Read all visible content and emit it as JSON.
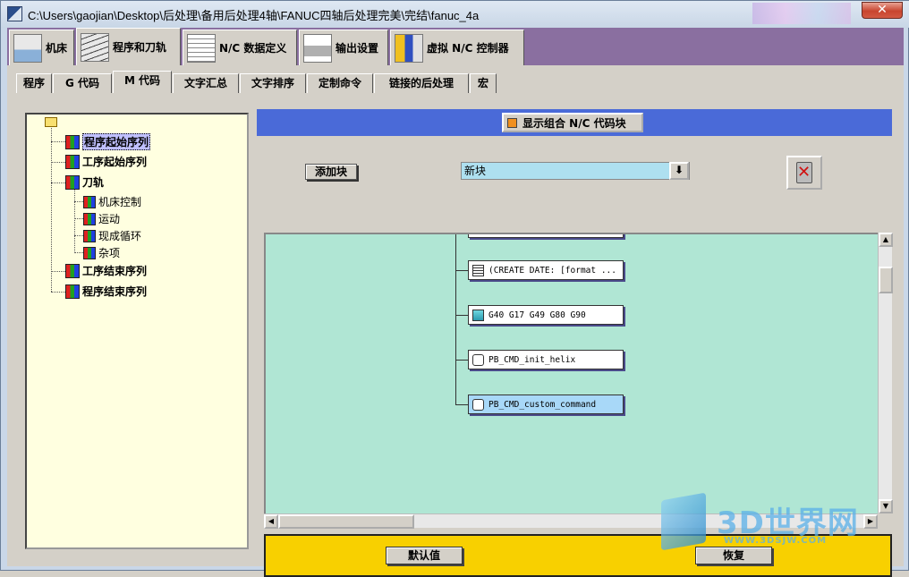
{
  "window": {
    "title": "C:\\Users\\gaojian\\Desktop\\后处理\\备用后处理4轴\\FANUC四轴后处理完美\\完结\\fanuc_4a",
    "close": "✕"
  },
  "main_tabs": [
    {
      "label": "机床",
      "icon": "machine-icon"
    },
    {
      "label": "程序和刀轨",
      "icon": "program-path-icon"
    },
    {
      "label": "N/C 数据定义",
      "icon": "nc-data-icon"
    },
    {
      "label": "输出设置",
      "icon": "printer-icon"
    },
    {
      "label": "虚拟 N/C 控制器",
      "icon": "virtual-controller-icon"
    }
  ],
  "sub_tabs": [
    "程序",
    "G 代码",
    "M 代码",
    "文字汇总",
    "文字排序",
    "定制命令",
    "链接的后处理",
    "宏"
  ],
  "tree": {
    "items": [
      {
        "label": "程序起始序列",
        "selected": true
      },
      {
        "label": "工序起始序列"
      },
      {
        "label": "刀轨"
      },
      {
        "label": "机床控制"
      },
      {
        "label": "运动"
      },
      {
        "label": "现成循环"
      },
      {
        "label": "杂项"
      },
      {
        "label": "工序结束序列"
      },
      {
        "label": "程序结束序列"
      }
    ]
  },
  "panel": {
    "show_combined_label": "显示组合 N/C 代码块",
    "add_block_label": "添加块",
    "combo_value": "新块",
    "combo_arrow": "⬇"
  },
  "blocks": [
    {
      "text": "(CREATE DATE: [format ...",
      "icon": "document-icon"
    },
    {
      "text": "G40 G17 G49 G80 G90",
      "icon": "cube-icon"
    },
    {
      "text": "PB_CMD_init_helix",
      "icon": "hand-icon"
    },
    {
      "text": "PB_CMD_custom_command",
      "icon": "hand-icon",
      "selected": true
    }
  ],
  "footer": {
    "default_label": "默认值",
    "restore_label": "恢复"
  },
  "watermark": {
    "text": "3D世界网",
    "url": "WWW.3DSJW.COM"
  }
}
